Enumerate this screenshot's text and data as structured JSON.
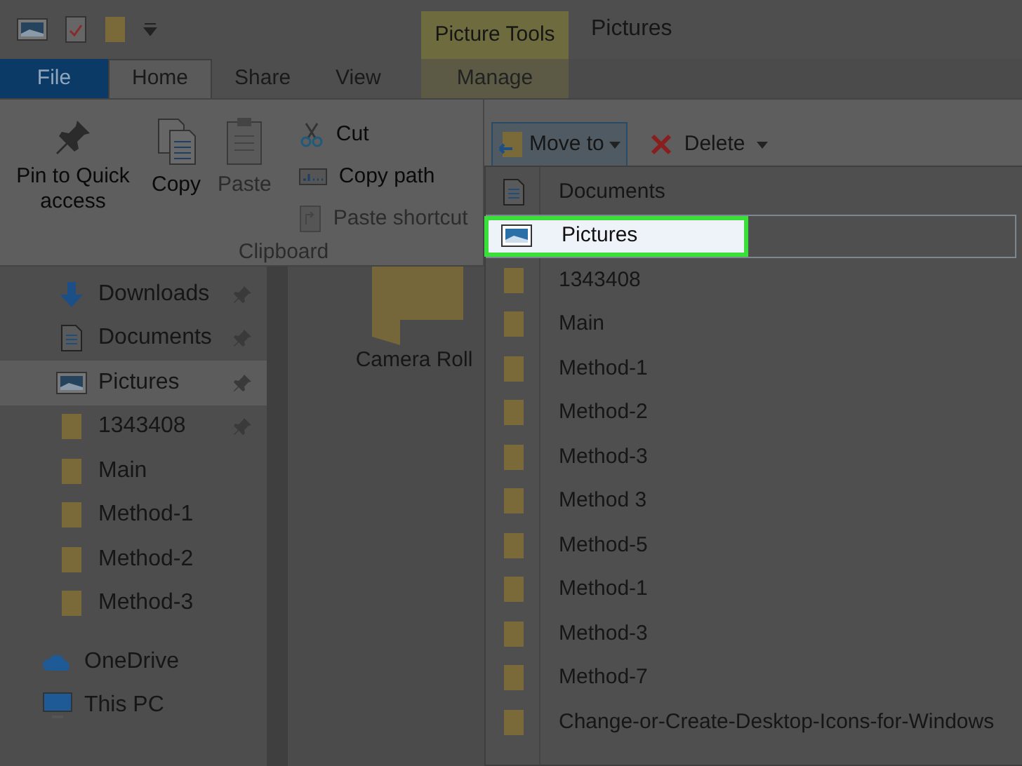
{
  "title_bar": {
    "context_tab": "Picture Tools",
    "title": "Pictures"
  },
  "tabs": [
    {
      "label": "File",
      "kind": "file",
      "selected": false
    },
    {
      "label": "Home",
      "kind": "normal",
      "selected": true
    },
    {
      "label": "Share",
      "kind": "normal",
      "selected": false
    },
    {
      "label": "View",
      "kind": "normal",
      "selected": false
    },
    {
      "label": "Manage",
      "kind": "context",
      "selected": false
    }
  ],
  "ribbon": {
    "clipboard": {
      "label": "Clipboard",
      "large_buttons": [
        {
          "label": "Pin to Quick access",
          "kind": "pin",
          "disabled": false
        },
        {
          "label": "Copy",
          "kind": "copy",
          "disabled": false
        },
        {
          "label": "Paste",
          "kind": "paste",
          "disabled": true
        }
      ],
      "small_buttons": [
        {
          "label": "Cut",
          "kind": "cut",
          "disabled": false
        },
        {
          "label": "Copy path",
          "kind": "path",
          "disabled": false
        },
        {
          "label": "Paste shortcut",
          "kind": "shortcut",
          "disabled": true
        }
      ]
    },
    "organize": {
      "move_to": "Move to",
      "delete": "Delete"
    }
  },
  "nav": {
    "quick_access": [
      {
        "label": "Downloads",
        "kind": "download",
        "pinned": true,
        "selected": false
      },
      {
        "label": "Documents",
        "kind": "document",
        "pinned": true,
        "selected": false
      },
      {
        "label": "Pictures",
        "kind": "picture",
        "pinned": true,
        "selected": true
      },
      {
        "label": "1343408",
        "kind": "folder",
        "pinned": true,
        "selected": false
      },
      {
        "label": "Main",
        "kind": "folder",
        "pinned": false,
        "selected": false
      },
      {
        "label": "Method-1",
        "kind": "folder",
        "pinned": false,
        "selected": false
      },
      {
        "label": "Method-2",
        "kind": "folder",
        "pinned": false,
        "selected": false
      },
      {
        "label": "Method-3",
        "kind": "folder",
        "pinned": false,
        "selected": false
      }
    ],
    "locations": [
      {
        "label": "OneDrive",
        "kind": "cloud"
      },
      {
        "label": "This PC",
        "kind": "pc"
      }
    ]
  },
  "content": {
    "items": [
      {
        "label": "Camera Roll"
      }
    ]
  },
  "move_to_menu": {
    "items": [
      {
        "label": "Documents",
        "kind": "document",
        "selected": false
      },
      {
        "label": "Pictures",
        "kind": "picture",
        "selected": true
      },
      {
        "label": "1343408",
        "kind": "folder",
        "selected": false
      },
      {
        "label": "Main",
        "kind": "folder",
        "selected": false
      },
      {
        "label": "Method-1",
        "kind": "folder",
        "selected": false
      },
      {
        "label": "Method-2",
        "kind": "folder",
        "selected": false
      },
      {
        "label": "Method-3",
        "kind": "folder",
        "selected": false
      },
      {
        "label": "Method 3",
        "kind": "folder",
        "selected": false
      },
      {
        "label": "Method-5",
        "kind": "folder",
        "selected": false
      },
      {
        "label": "Method-1",
        "kind": "folder",
        "selected": false
      },
      {
        "label": "Method-3",
        "kind": "folder",
        "selected": false
      },
      {
        "label": "Method-7",
        "kind": "folder",
        "selected": false
      },
      {
        "label": "Change-or-Create-Desktop-Icons-for-Windows",
        "kind": "folder",
        "selected": false
      }
    ]
  }
}
